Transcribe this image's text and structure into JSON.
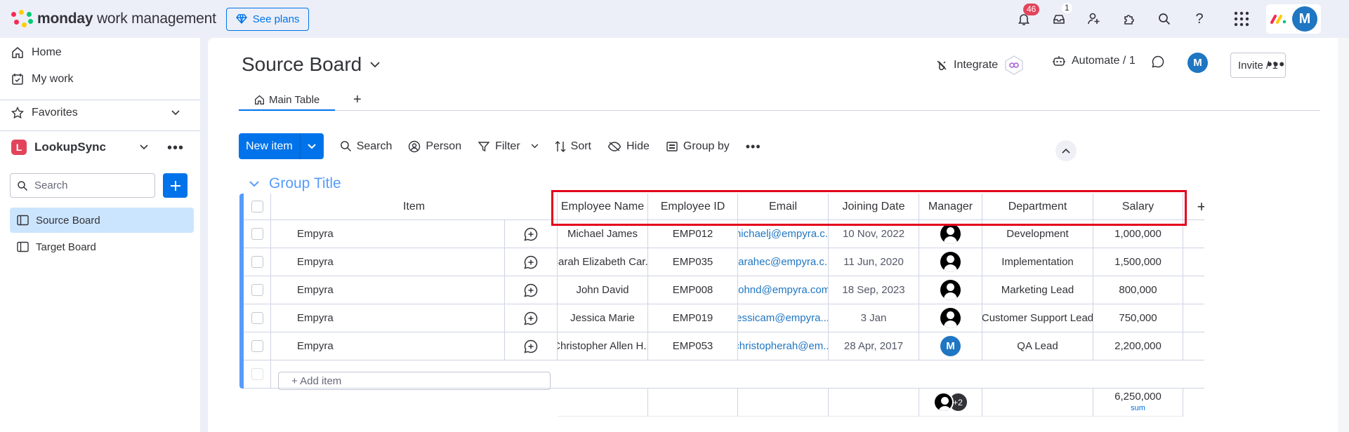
{
  "topbar": {
    "brand_bold": "monday",
    "brand_rest": " work management",
    "see_plans": "See plans",
    "notif_count": "46",
    "inbox_count": "1",
    "avatar": "M"
  },
  "sidebar": {
    "home": "Home",
    "my_work": "My work",
    "favorites": "Favorites",
    "workspace_letter": "L",
    "workspace": "LookupSync",
    "search_placeholder": "Search",
    "boards": [
      "Source Board",
      "Target Board"
    ]
  },
  "board": {
    "title": "Source Board",
    "tab": "Main Table",
    "tab_add": "+",
    "integrate": "Integrate",
    "automate": "Automate / 1",
    "owner_avatar": "M",
    "invite": "Invite / 1"
  },
  "toolbar": {
    "new_item": "New item",
    "search": "Search",
    "person": "Person",
    "filter": "Filter",
    "sort": "Sort",
    "hide": "Hide",
    "group_by": "Group by"
  },
  "group": {
    "title": "Group Title",
    "columns": [
      "Item",
      "Employee Name",
      "Employee ID",
      "Email",
      "Joining Date",
      "Manager",
      "Department",
      "Salary"
    ],
    "rows": [
      {
        "item": "Empyra",
        "name": "Michael James",
        "id": "EMP012",
        "email": "michaelj@empyra.c...",
        "date": "10 Nov, 2022",
        "manager": "person",
        "department": "Development",
        "salary": "1,000,000"
      },
      {
        "item": "Empyra",
        "name": "Sarah Elizabeth Car...",
        "id": "EMP035",
        "email": "sarahec@empyra.c...",
        "date": "11 Jun, 2020",
        "manager": "person",
        "department": "Implementation",
        "salary": "1,500,000"
      },
      {
        "item": "Empyra",
        "name": "John David",
        "id": "EMP008",
        "email": "johnd@empyra.com",
        "date": "18 Sep, 2023",
        "manager": "person",
        "department": "Marketing Lead",
        "salary": "800,000"
      },
      {
        "item": "Empyra",
        "name": "Jessica Marie",
        "id": "EMP019",
        "email": "jessicam@empyra....",
        "date": "3 Jan",
        "manager": "person",
        "department": "Customer Support Lead",
        "salary": "750,000"
      },
      {
        "item": "Empyra",
        "name": "Christopher Allen H...",
        "id": "EMP053",
        "email": "christopherah@em...",
        "date": "28 Apr, 2017",
        "manager": "M",
        "department": "QA Lead",
        "salary": "2,200,000"
      }
    ],
    "add_item": "+ Add item",
    "summary": {
      "manager_more": "+2",
      "salary_total": "6,250,000",
      "salary_label": "sum"
    }
  }
}
